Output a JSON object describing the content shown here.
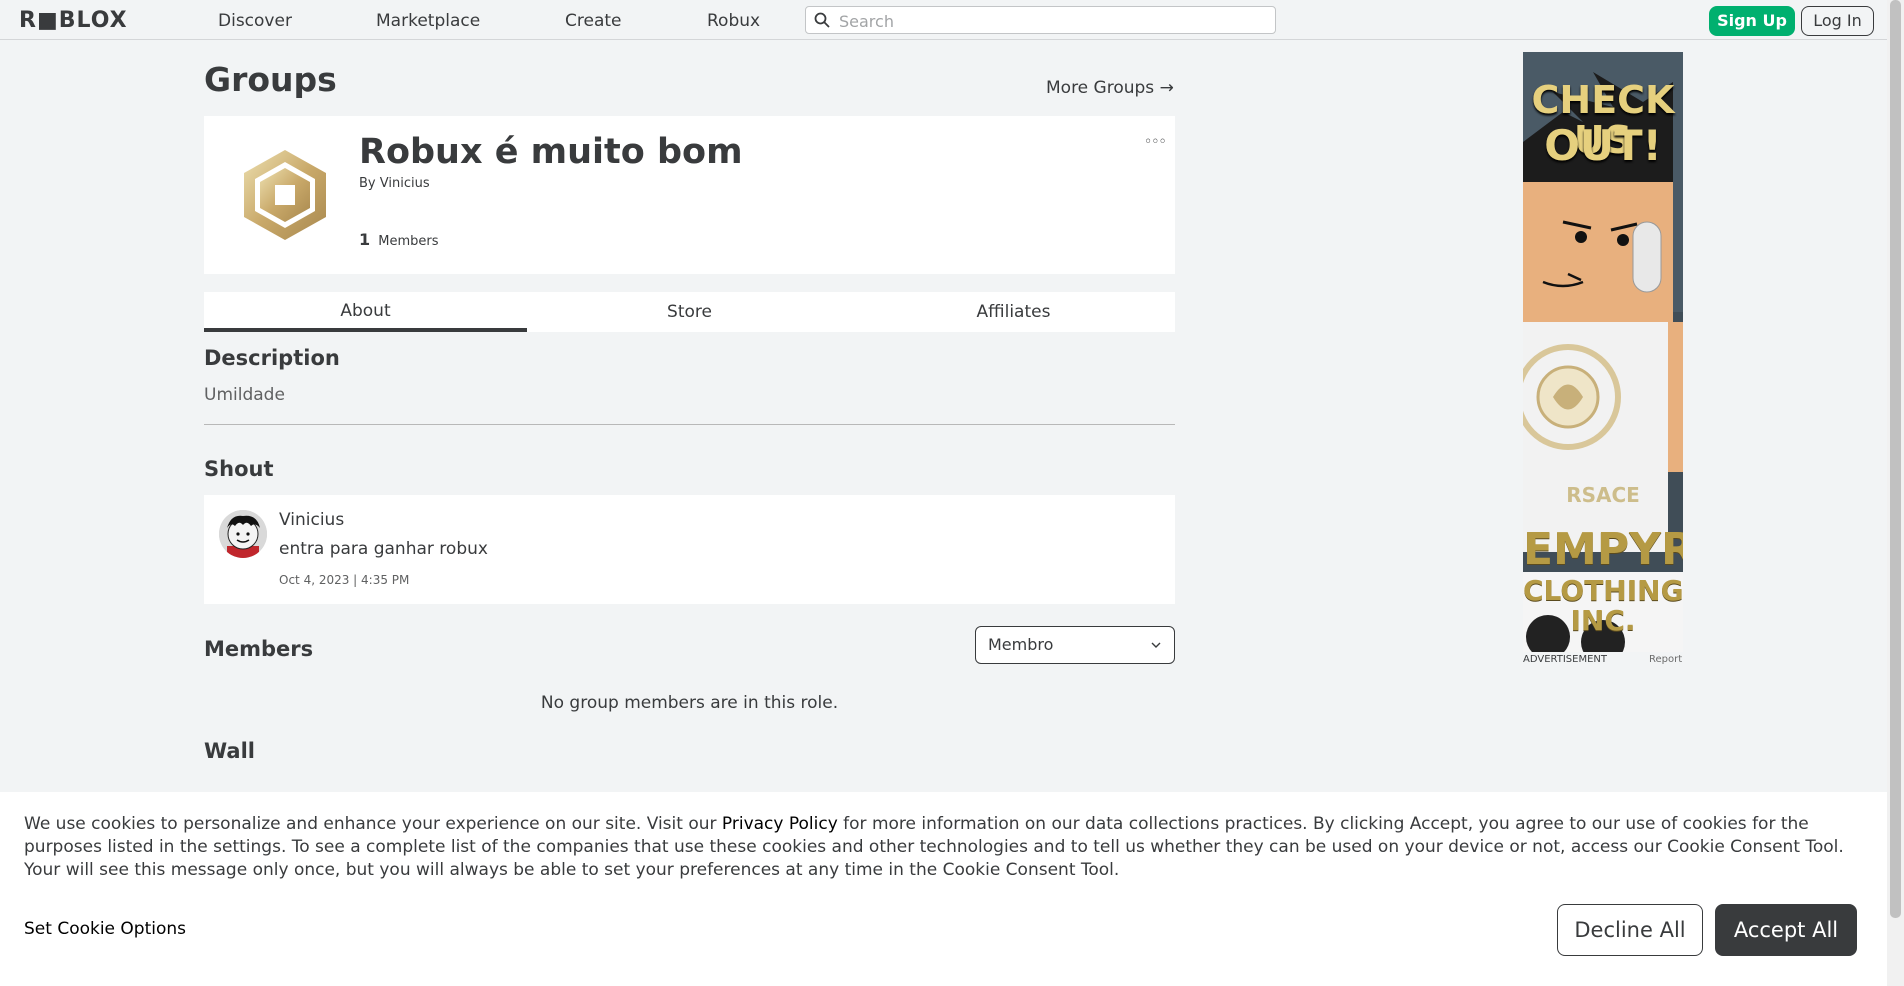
{
  "nav": {
    "logo": "R■BLOX",
    "links": [
      "Discover",
      "Marketplace",
      "Create",
      "Robux"
    ],
    "search_placeholder": "Search",
    "signup_label": "Sign Up",
    "login_label": "Log In"
  },
  "page": {
    "title": "Groups",
    "more_groups": "More Groups →"
  },
  "group": {
    "name": "Robux é muito bom",
    "by_prefix": "By",
    "owner": "Vinicius",
    "member_count": "1",
    "members_label": "Members",
    "menu_glyph": "◦◦◦"
  },
  "tabs": [
    "About",
    "Store",
    "Affiliates"
  ],
  "description": {
    "title": "Description",
    "text": "Umildade"
  },
  "shout": {
    "title": "Shout",
    "user": "Vinicius",
    "body": "entra para ganhar robux",
    "date": "Oct 4, 2023 | 4:35 PM"
  },
  "members": {
    "title": "Members",
    "role_selected": "Membro",
    "empty_text": "No group members are in this role."
  },
  "wall": {
    "title": "Wall"
  },
  "ad": {
    "line1": "CHECK US",
    "line2": "OUT!",
    "brand1": "EMPYRE",
    "brand2": "CLOTHING INC.",
    "shirt_text": "RSACE",
    "label": "ADVERTISEMENT",
    "report": "Report"
  },
  "cookie": {
    "text_before": "We use cookies to personalize and enhance your experience on our site. Visit our ",
    "privacy_link": "Privacy Policy",
    "text_after": " for more information on our data collections practices. By clicking Accept, you agree to our use of cookies for the purposes listed in the settings. To see a complete list of the companies that use these cookies and other technologies and to tell us whether they can be used on your device or not, access our Cookie Consent Tool. Your will see this message only once, but you will always be able to set your preferences at any time in the Cookie Consent Tool.",
    "set_options": "Set Cookie Options",
    "decline": "Decline All",
    "accept": "Accept All"
  },
  "colors": {
    "signup_green": "#00b06f",
    "accept_dark": "#393b3d",
    "background": "#f2f4f5"
  }
}
